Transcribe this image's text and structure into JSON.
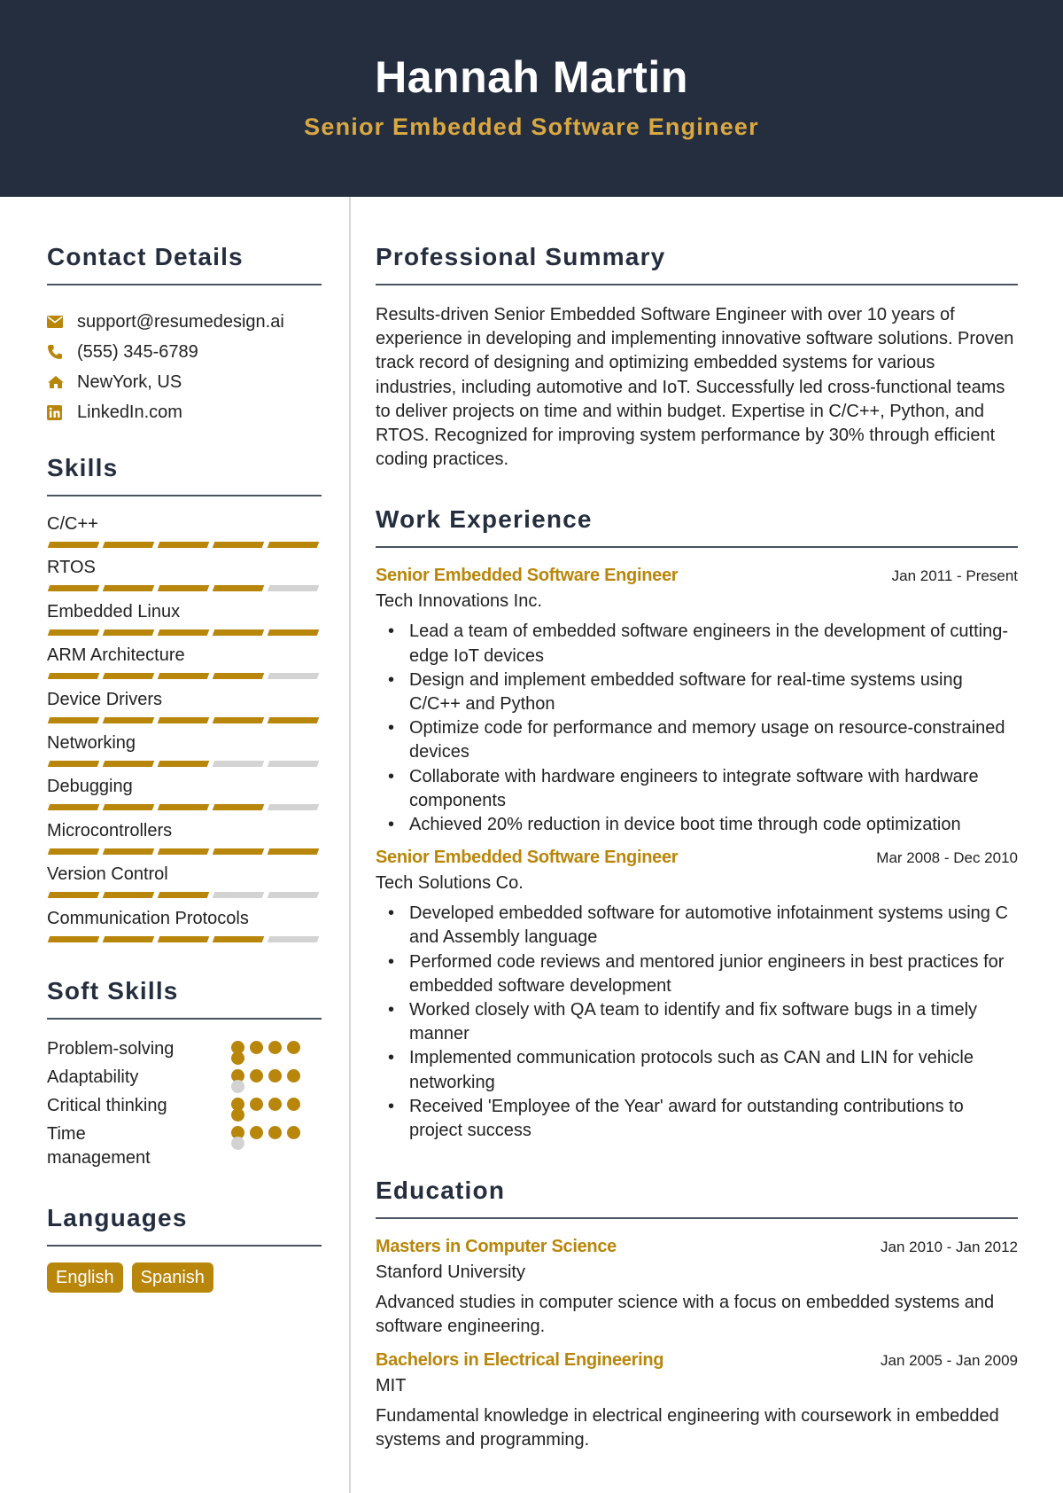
{
  "header": {
    "name": "Hannah Martin",
    "title": "Senior Embedded Software Engineer"
  },
  "colors": {
    "header_bg": "#252e3f",
    "accent": "#b8860b",
    "title_gold": "#d9a842",
    "inactive": "#d3d3d3"
  },
  "contact": {
    "title": "Contact Details",
    "items": [
      {
        "icon": "envelope-icon",
        "text": "support@resumedesign.ai"
      },
      {
        "icon": "phone-icon",
        "text": "(555) 345-6789"
      },
      {
        "icon": "home-icon",
        "text": "NewYork, US"
      },
      {
        "icon": "linkedin-icon",
        "text": "LinkedIn.com"
      }
    ]
  },
  "skills": {
    "title": "Skills",
    "max_level": 5,
    "items": [
      {
        "name": "C/C++",
        "level": 5
      },
      {
        "name": "RTOS",
        "level": 4
      },
      {
        "name": "Embedded Linux",
        "level": 5
      },
      {
        "name": "ARM Architecture",
        "level": 4
      },
      {
        "name": "Device Drivers",
        "level": 5
      },
      {
        "name": "Networking",
        "level": 3
      },
      {
        "name": "Debugging",
        "level": 4
      },
      {
        "name": "Microcontrollers",
        "level": 5
      },
      {
        "name": "Version Control",
        "level": 3
      },
      {
        "name": "Communication Protocols",
        "level": 4
      }
    ]
  },
  "soft_skills": {
    "title": "Soft Skills",
    "max_level": 5,
    "items": [
      {
        "name": "Problem-solving",
        "level": 5
      },
      {
        "name": "Adaptability",
        "level": 4
      },
      {
        "name": "Critical thinking",
        "level": 5
      },
      {
        "name": "Time management",
        "level": 4
      }
    ]
  },
  "languages": {
    "title": "Languages",
    "items": [
      "English",
      "Spanish"
    ]
  },
  "summary": {
    "title": "Professional Summary",
    "text": "Results-driven Senior Embedded Software Engineer with over 10 years of experience in developing and implementing innovative software solutions. Proven track record of designing and optimizing embedded systems for various industries, including automotive and IoT. Successfully led cross-functional teams to deliver projects on time and within budget. Expertise in C/C++, Python, and RTOS. Recognized for improving system performance by 30% through efficient coding practices."
  },
  "work": {
    "title": "Work Experience",
    "entries": [
      {
        "role": "Senior Embedded Software Engineer",
        "dates": "Jan 2011 - Present",
        "company": "Tech Innovations Inc.",
        "bullets": [
          "Lead a team of embedded software engineers in the development of cutting-edge IoT devices",
          "Design and implement embedded software for real-time systems using C/C++ and Python",
          "Optimize code for performance and memory usage on resource-constrained devices",
          "Collaborate with hardware engineers to integrate software with hardware components",
          "Achieved 20% reduction in device boot time through code optimization"
        ]
      },
      {
        "role": "Senior Embedded Software Engineer",
        "dates": "Mar 2008 - Dec 2010",
        "company": "Tech Solutions Co.",
        "bullets": [
          "Developed embedded software for automotive infotainment systems using C and Assembly language",
          "Performed code reviews and mentored junior engineers in best practices for embedded software development",
          "Worked closely with QA team to identify and fix software bugs in a timely manner",
          "Implemented communication protocols such as CAN and LIN for vehicle networking",
          "Received 'Employee of the Year' award for outstanding contributions to project success"
        ]
      }
    ]
  },
  "education": {
    "title": "Education",
    "entries": [
      {
        "degree": "Masters in Computer Science",
        "dates": "Jan 2010 - Jan 2012",
        "school": "Stanford University",
        "description": "Advanced studies in computer science with a focus on embedded systems and software engineering."
      },
      {
        "degree": "Bachelors in Electrical Engineering",
        "dates": "Jan 2005 - Jan 2009",
        "school": "MIT",
        "description": "Fundamental knowledge in electrical engineering with coursework in embedded systems and programming."
      }
    ]
  }
}
